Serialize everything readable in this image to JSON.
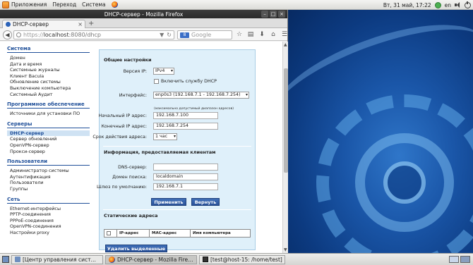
{
  "top_panel": {
    "applications": "Приложения",
    "places": "Переход",
    "system": "Система",
    "datetime": "Вт, 31 май, 17:22",
    "keyboard_layout": "en"
  },
  "window": {
    "title": "DHCP-сервер - Mozilla Firefox",
    "minimize": "–",
    "maximize": "□",
    "close": "×"
  },
  "tab": {
    "label": "DHCP-сервер",
    "close": "×",
    "new_tab": "+"
  },
  "navbar": {
    "url_proto": "https://",
    "url_host": "localhost",
    "url_path": ":8080/dhcp",
    "search_placeholder": "Google",
    "search_engine": "8",
    "reload": "↻",
    "dropdown": "▼"
  },
  "sidebar": {
    "sections": [
      {
        "title": "Система",
        "items": [
          "Домен",
          "Дата и время",
          "Системные журналы",
          "Клиент Bacula",
          "Обновление системы",
          "Выключение компьютера",
          "Системный Аудит"
        ]
      },
      {
        "title": "Программное обеспечение",
        "items": [
          "Источники для установки ПО"
        ]
      },
      {
        "title": "Серверы",
        "items": [
          "DHCP-сервер",
          "Сервер обновлений",
          "OpenVPN-сервер",
          "Прокси-сервер"
        ],
        "active": "DHCP-сервер"
      },
      {
        "title": "Пользователи",
        "items": [
          "Администратор системы",
          "Аутентификация",
          "Пользователи",
          "Группы"
        ]
      },
      {
        "title": "Сеть",
        "items": [
          "Ethernet-интерфейсы",
          "PPTP-соединения",
          "PPPoE-соединения",
          "OpenVPN-соединения",
          "Настройки proxy"
        ]
      }
    ]
  },
  "form": {
    "general_title": "Общие настройки",
    "ip_version_label": "Версия IP:",
    "ip_version_value": "IPv4",
    "enable_label": "Включить службу DHCP",
    "interface_label": "Интерфейс:",
    "interface_value": "enp0s3 (192.168.7.1 - 192.168.7.254)",
    "range_hint": "(максимально допустимый диапазон адресов)",
    "start_label": "Начальный IP адрес:",
    "start_value": "192.168.7.100",
    "end_label": "Конечный IP адрес:",
    "end_value": "192.168.7.254",
    "lease_label": "Срок действия адреса:",
    "lease_value": "1 час",
    "client_info_title": "Информация, предоставляемая клиентам",
    "dns_label": "DNS-сервер:",
    "dns_value": "",
    "domain_label": "Домен поиска:",
    "domain_value": "localdomain",
    "gateway_label": "Шлюз по умолчанию:",
    "gateway_value": "192.168.7.1",
    "apply_button": "Применить",
    "revert_button": "Вернуть",
    "static_title": "Статические адреса",
    "table_headers": [
      "IP-адрес",
      "MAC-адрес",
      "Имя компьютера"
    ],
    "delete_button": "Удалить выделенные"
  },
  "taskbar": {
    "tasks": [
      {
        "label": "[Центр управления сист…",
        "active": false
      },
      {
        "label": "DHCP-сервер - Mozilla Fire…",
        "active": true
      },
      {
        "label": "[test@host-15: /home/test]",
        "active": false
      }
    ]
  },
  "colors": {
    "section_header": "#1f4f99",
    "panel_bg": "#dff0fa",
    "button_bg": "#2a5299",
    "active_nav_bg": "#cfe2f3"
  }
}
